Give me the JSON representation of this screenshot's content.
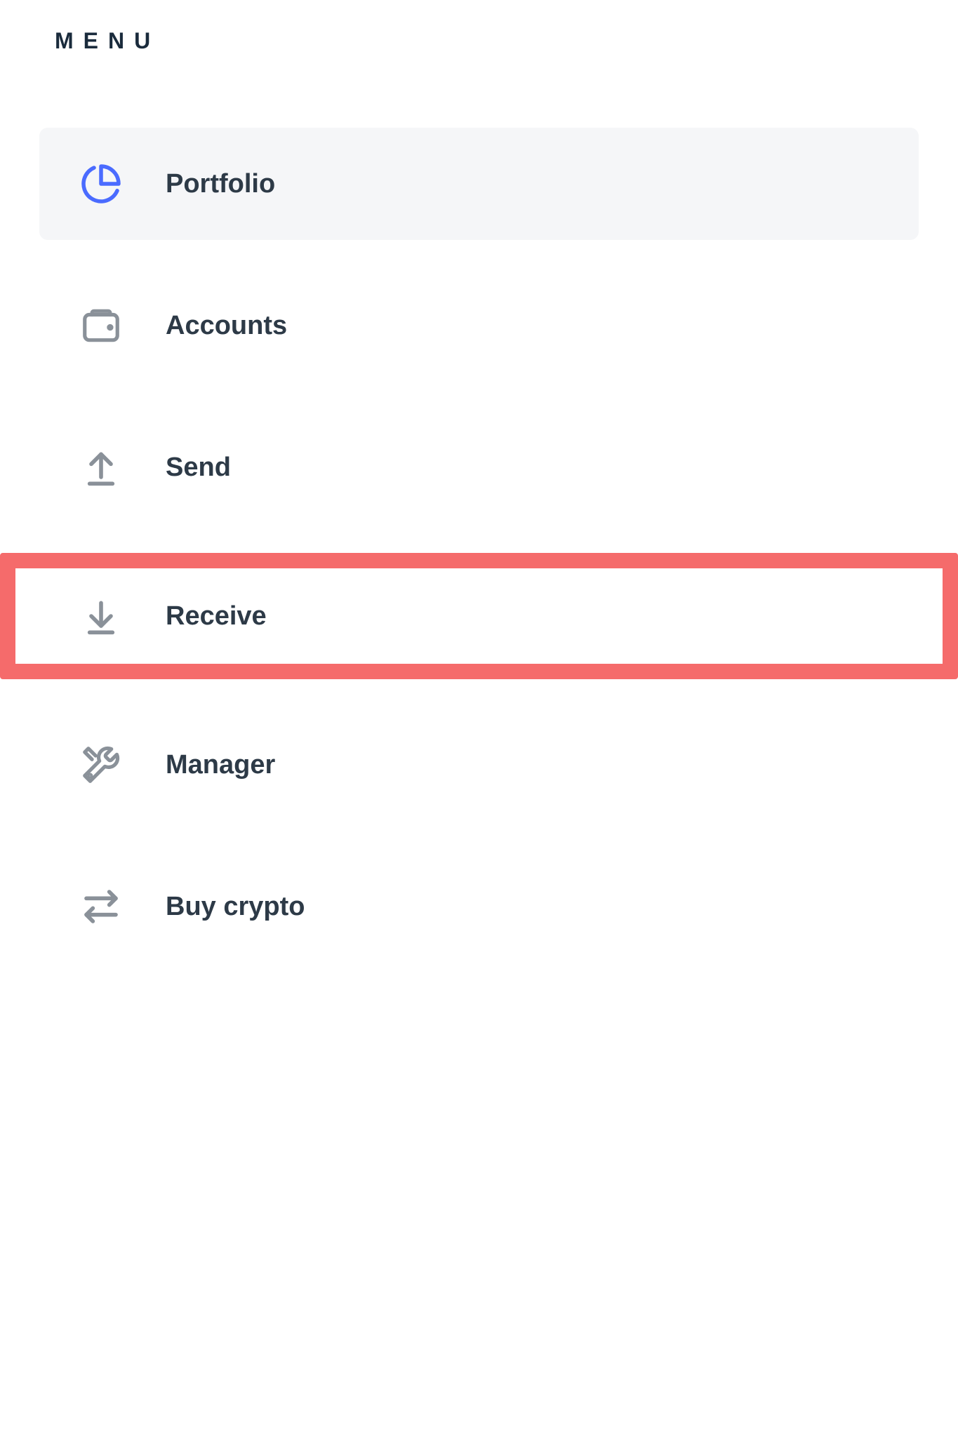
{
  "menu": {
    "heading": "MENU",
    "items": [
      {
        "id": "portfolio",
        "label": "Portfolio",
        "icon": "pie-chart-icon",
        "active": true,
        "highlighted": false
      },
      {
        "id": "accounts",
        "label": "Accounts",
        "icon": "wallet-icon",
        "active": false,
        "highlighted": false
      },
      {
        "id": "send",
        "label": "Send",
        "icon": "arrow-up-icon",
        "active": false,
        "highlighted": false
      },
      {
        "id": "receive",
        "label": "Receive",
        "icon": "arrow-down-icon",
        "active": false,
        "highlighted": true
      },
      {
        "id": "manager",
        "label": "Manager",
        "icon": "tools-icon",
        "active": false,
        "highlighted": false
      },
      {
        "id": "buy-crypto",
        "label": "Buy crypto",
        "icon": "swap-icon",
        "active": false,
        "highlighted": false
      }
    ]
  },
  "colors": {
    "accent": "#4a6bff",
    "highlight_border": "#f56b6b",
    "inactive_icon": "#8a9199",
    "text": "#2d3a47"
  }
}
